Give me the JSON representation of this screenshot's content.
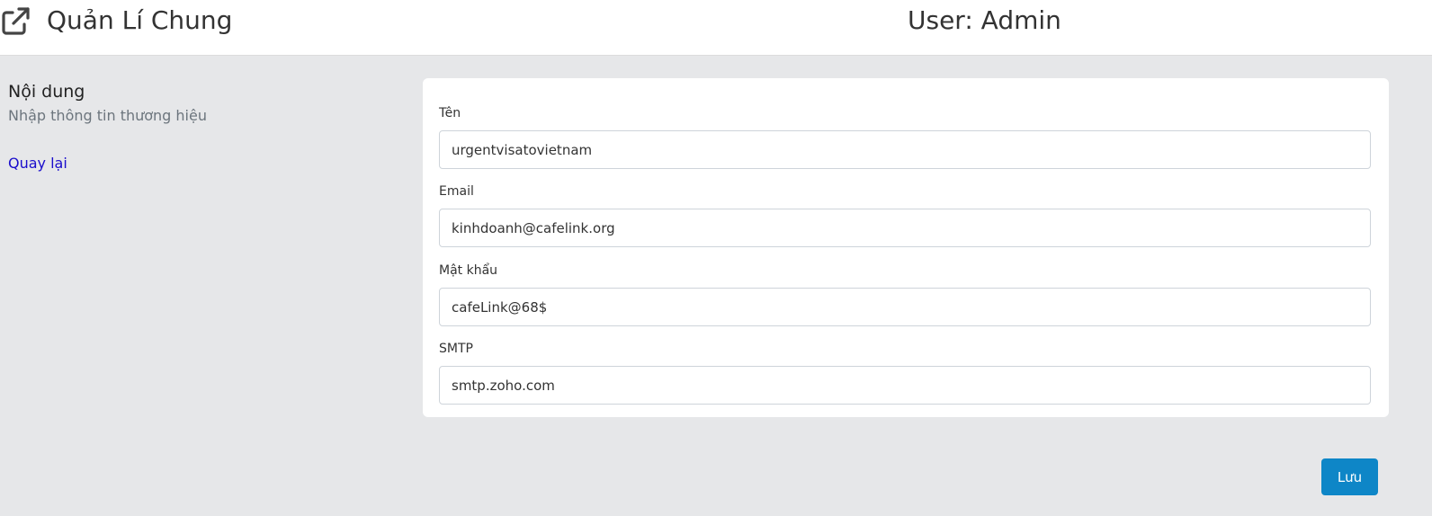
{
  "header": {
    "icon": "external-link-icon",
    "title": "Quản Lí Chung",
    "user_label": "User: Admin"
  },
  "sidebar": {
    "heading": "Nội dung",
    "subheading": "Nhập thông tin thương hiệu",
    "back_link": "Quay lại",
    "link_color": "#1a0dcc"
  },
  "form": {
    "fields": [
      {
        "label": "Tên",
        "value": "urgentvisatovietnam"
      },
      {
        "label": "Email",
        "value": "kinhdoanh@cafelink.org"
      },
      {
        "label": "Mật khẩu",
        "value": "cafeLink@68$"
      },
      {
        "label": "SMTP",
        "value": "smtp.zoho.com"
      }
    ]
  },
  "actions": {
    "save_label": "Lưu",
    "save_color": "#0e86c7"
  },
  "colors": {
    "page_background": "#e6e7e9",
    "header_background": "#ffffff"
  }
}
